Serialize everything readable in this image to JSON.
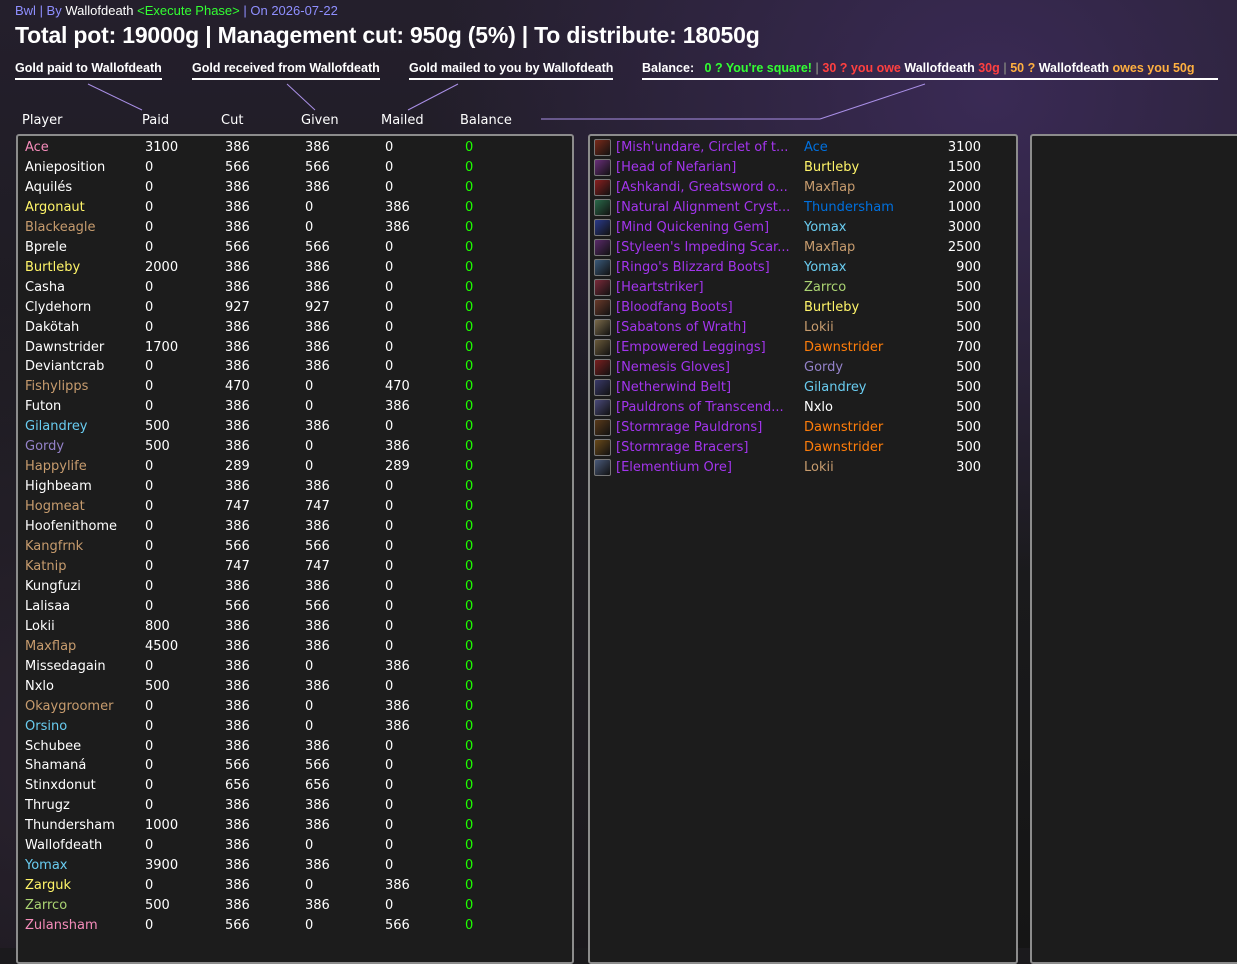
{
  "header": {
    "raid": "Bwl",
    "sep1": " | By ",
    "by": "Wallofdeath",
    "phase": " <Execute Phase>",
    "sep2": " | On 2026-07-22",
    "title": "Total pot: 19000g | Management cut: 950g (5%) | To distribute: 18050g"
  },
  "legend": {
    "paid": "Gold paid to Wallofdeath",
    "received": "Gold received from Wallofdeath",
    "mailed": "Gold mailed to you by Wallofdeath",
    "balance_label": "Balance:",
    "square": "0 ? You're square!",
    "sep": " | ",
    "owe_prefix": "30 ? you owe ",
    "owe_name": "Wallofdeath",
    "owe_amount": " 30g",
    "sep2": " | ",
    "owes_prefix": "50 ? ",
    "owes_name": "Wallofdeath",
    "owes_suffix": " owes you 50g"
  },
  "columns": [
    "Player",
    "Paid",
    "Cut",
    "Given",
    "Mailed",
    "Balance"
  ],
  "colors": {
    "paladin": "#f58cba",
    "warrior": "#c79c6e",
    "rogue": "#fff569",
    "priest": "#ffffff",
    "hunter": "#abd473",
    "mage": "#69ccf0",
    "warlock": "#9482c9",
    "shaman": "#0070de",
    "druid": "#ff7d0a",
    "epic": "#a335ee",
    "balance_zero": "#1eff00"
  },
  "players": [
    {
      "name": "Ace",
      "cls": "paladin",
      "paid": "3100",
      "cut": "386",
      "given": "386",
      "mailed": "0",
      "balance": "0"
    },
    {
      "name": "Anieposition",
      "cls": "priest",
      "paid": "0",
      "cut": "566",
      "given": "566",
      "mailed": "0",
      "balance": "0"
    },
    {
      "name": "Aquilés",
      "cls": "priest",
      "paid": "0",
      "cut": "386",
      "given": "386",
      "mailed": "0",
      "balance": "0"
    },
    {
      "name": "Argonaut",
      "cls": "rogue",
      "paid": "0",
      "cut": "386",
      "given": "0",
      "mailed": "386",
      "balance": "0"
    },
    {
      "name": "Blackeagle",
      "cls": "warrior",
      "paid": "0",
      "cut": "386",
      "given": "0",
      "mailed": "386",
      "balance": "0"
    },
    {
      "name": "Bprele",
      "cls": "priest",
      "paid": "0",
      "cut": "566",
      "given": "566",
      "mailed": "0",
      "balance": "0"
    },
    {
      "name": "Burtleby",
      "cls": "rogue",
      "paid": "2000",
      "cut": "386",
      "given": "386",
      "mailed": "0",
      "balance": "0"
    },
    {
      "name": "Casha",
      "cls": "priest",
      "paid": "0",
      "cut": "386",
      "given": "386",
      "mailed": "0",
      "balance": "0"
    },
    {
      "name": "Clydehorn",
      "cls": "priest",
      "paid": "0",
      "cut": "927",
      "given": "927",
      "mailed": "0",
      "balance": "0"
    },
    {
      "name": "Dakötah",
      "cls": "priest",
      "paid": "0",
      "cut": "386",
      "given": "386",
      "mailed": "0",
      "balance": "0"
    },
    {
      "name": "Dawnstrider",
      "cls": "priest",
      "paid": "1700",
      "cut": "386",
      "given": "386",
      "mailed": "0",
      "balance": "0"
    },
    {
      "name": "Deviantcrab",
      "cls": "priest",
      "paid": "0",
      "cut": "386",
      "given": "386",
      "mailed": "0",
      "balance": "0"
    },
    {
      "name": "Fishylipps",
      "cls": "warrior",
      "paid": "0",
      "cut": "470",
      "given": "0",
      "mailed": "470",
      "balance": "0"
    },
    {
      "name": "Futon",
      "cls": "priest",
      "paid": "0",
      "cut": "386",
      "given": "0",
      "mailed": "386",
      "balance": "0"
    },
    {
      "name": "Gilandrey",
      "cls": "mage",
      "paid": "500",
      "cut": "386",
      "given": "386",
      "mailed": "0",
      "balance": "0"
    },
    {
      "name": "Gordy",
      "cls": "warlock",
      "paid": "500",
      "cut": "386",
      "given": "0",
      "mailed": "386",
      "balance": "0"
    },
    {
      "name": "Happylife",
      "cls": "warrior",
      "paid": "0",
      "cut": "289",
      "given": "0",
      "mailed": "289",
      "balance": "0"
    },
    {
      "name": "Highbeam",
      "cls": "priest",
      "paid": "0",
      "cut": "386",
      "given": "386",
      "mailed": "0",
      "balance": "0"
    },
    {
      "name": "Hogmeat",
      "cls": "warrior",
      "paid": "0",
      "cut": "747",
      "given": "747",
      "mailed": "0",
      "balance": "0"
    },
    {
      "name": "Hoofenithome",
      "cls": "priest",
      "paid": "0",
      "cut": "386",
      "given": "386",
      "mailed": "0",
      "balance": "0"
    },
    {
      "name": "Kangfrnk",
      "cls": "warrior",
      "paid": "0",
      "cut": "566",
      "given": "566",
      "mailed": "0",
      "balance": "0"
    },
    {
      "name": "Katnip",
      "cls": "warrior",
      "paid": "0",
      "cut": "747",
      "given": "747",
      "mailed": "0",
      "balance": "0"
    },
    {
      "name": "Kungfuzi",
      "cls": "priest",
      "paid": "0",
      "cut": "386",
      "given": "386",
      "mailed": "0",
      "balance": "0"
    },
    {
      "name": "Lalisaa",
      "cls": "priest",
      "paid": "0",
      "cut": "566",
      "given": "566",
      "mailed": "0",
      "balance": "0"
    },
    {
      "name": "Lokii",
      "cls": "priest",
      "paid": "800",
      "cut": "386",
      "given": "386",
      "mailed": "0",
      "balance": "0"
    },
    {
      "name": "Maxflap",
      "cls": "warrior",
      "paid": "4500",
      "cut": "386",
      "given": "386",
      "mailed": "0",
      "balance": "0"
    },
    {
      "name": "Missedagain",
      "cls": "priest",
      "paid": "0",
      "cut": "386",
      "given": "0",
      "mailed": "386",
      "balance": "0"
    },
    {
      "name": "Nxlo",
      "cls": "priest",
      "paid": "500",
      "cut": "386",
      "given": "386",
      "mailed": "0",
      "balance": "0"
    },
    {
      "name": "Okaygroomer",
      "cls": "warrior",
      "paid": "0",
      "cut": "386",
      "given": "0",
      "mailed": "386",
      "balance": "0"
    },
    {
      "name": "Orsino",
      "cls": "mage",
      "paid": "0",
      "cut": "386",
      "given": "0",
      "mailed": "386",
      "balance": "0"
    },
    {
      "name": "Schubee",
      "cls": "priest",
      "paid": "0",
      "cut": "386",
      "given": "386",
      "mailed": "0",
      "balance": "0"
    },
    {
      "name": "Shamaná",
      "cls": "priest",
      "paid": "0",
      "cut": "566",
      "given": "566",
      "mailed": "0",
      "balance": "0"
    },
    {
      "name": "Stinxdonut",
      "cls": "priest",
      "paid": "0",
      "cut": "656",
      "given": "656",
      "mailed": "0",
      "balance": "0"
    },
    {
      "name": "Thrugz",
      "cls": "priest",
      "paid": "0",
      "cut": "386",
      "given": "386",
      "mailed": "0",
      "balance": "0"
    },
    {
      "name": "Thundersham",
      "cls": "priest",
      "paid": "1000",
      "cut": "386",
      "given": "386",
      "mailed": "0",
      "balance": "0"
    },
    {
      "name": "Wallofdeath",
      "cls": "priest",
      "paid": "0",
      "cut": "386",
      "given": "0",
      "mailed": "0",
      "balance": "0"
    },
    {
      "name": "Yomax",
      "cls": "mage",
      "paid": "3900",
      "cut": "386",
      "given": "386",
      "mailed": "0",
      "balance": "0"
    },
    {
      "name": "Zarguk",
      "cls": "rogue",
      "paid": "0",
      "cut": "386",
      "given": "0",
      "mailed": "386",
      "balance": "0"
    },
    {
      "name": "Zarrco",
      "cls": "hunter",
      "paid": "500",
      "cut": "386",
      "given": "386",
      "mailed": "0",
      "balance": "0"
    },
    {
      "name": "Zulansham",
      "cls": "paladin",
      "paid": "0",
      "cut": "566",
      "given": "0",
      "mailed": "566",
      "balance": "0"
    }
  ],
  "items": [
    {
      "name": "[Mish'undare, Circlet of t...",
      "icon": "circlet-icon",
      "icon_color": "#7a2a1a",
      "winner": "Ace",
      "wcls": "shaman",
      "price": "3100"
    },
    {
      "name": "[Head of Nefarian]",
      "icon": "dragon-head-icon",
      "icon_color": "#6a2f7a",
      "winner": "Burtleby",
      "wcls": "rogue",
      "price": "1500"
    },
    {
      "name": "[Ashkandi, Greatsword o...",
      "icon": "greatsword-icon",
      "icon_color": "#8a2020",
      "winner": "Maxflap",
      "wcls": "warrior",
      "price": "2000"
    },
    {
      "name": "[Natural Alignment Cryst...",
      "icon": "crystal-icon",
      "icon_color": "#2a6a4a",
      "winner": "Thundersham",
      "wcls": "shaman",
      "price": "1000"
    },
    {
      "name": "[Mind Quickening Gem]",
      "icon": "gem-icon",
      "icon_color": "#2a3a8a",
      "winner": "Yomax",
      "wcls": "mage",
      "price": "3000"
    },
    {
      "name": "[Styleen's Impeding Scar...",
      "icon": "scarab-icon",
      "icon_color": "#5a2a6a",
      "winner": "Maxflap",
      "wcls": "warrior",
      "price": "2500"
    },
    {
      "name": "[Ringo's Blizzard Boots]",
      "icon": "boots-icon",
      "icon_color": "#3a5a7a",
      "winner": "Yomax",
      "wcls": "mage",
      "price": "900"
    },
    {
      "name": "[Heartstriker]",
      "icon": "bow-icon",
      "icon_color": "#7a2a3a",
      "winner": "Zarrco",
      "wcls": "hunter",
      "price": "500"
    },
    {
      "name": "[Bloodfang Boots]",
      "icon": "boots-icon",
      "icon_color": "#6a3a2a",
      "winner": "Burtleby",
      "wcls": "rogue",
      "price": "500"
    },
    {
      "name": "[Sabatons of Wrath]",
      "icon": "sabatons-icon",
      "icon_color": "#7a6a4a",
      "winner": "Lokii",
      "wcls": "warrior",
      "price": "500"
    },
    {
      "name": "[Empowered Leggings]",
      "icon": "leggings-icon",
      "icon_color": "#6a5a3a",
      "winner": "Dawnstrider",
      "wcls": "druid",
      "price": "700"
    },
    {
      "name": "[Nemesis Gloves]",
      "icon": "gloves-icon",
      "icon_color": "#7a2020",
      "winner": "Gordy",
      "wcls": "warlock",
      "price": "500"
    },
    {
      "name": "[Netherwind Belt]",
      "icon": "belt-icon",
      "icon_color": "#3a3a6a",
      "winner": "Gilandrey",
      "wcls": "mage",
      "price": "500"
    },
    {
      "name": "[Pauldrons of Transcend...",
      "icon": "pauldrons-icon",
      "icon_color": "#4a4a7a",
      "winner": "Nxlo",
      "wcls": "priest",
      "price": "500"
    },
    {
      "name": "[Stormrage Pauldrons]",
      "icon": "pauldrons-icon",
      "icon_color": "#5a3a1a",
      "winner": "Dawnstrider",
      "wcls": "druid",
      "price": "500"
    },
    {
      "name": "[Stormrage Bracers]",
      "icon": "bracers-icon",
      "icon_color": "#6a4a1a",
      "winner": "Dawnstrider",
      "wcls": "druid",
      "price": "500"
    },
    {
      "name": "[Elementium Ore]",
      "icon": "ore-icon",
      "icon_color": "#4a5a7a",
      "winner": "Lokii",
      "wcls": "warrior",
      "price": "300"
    }
  ]
}
